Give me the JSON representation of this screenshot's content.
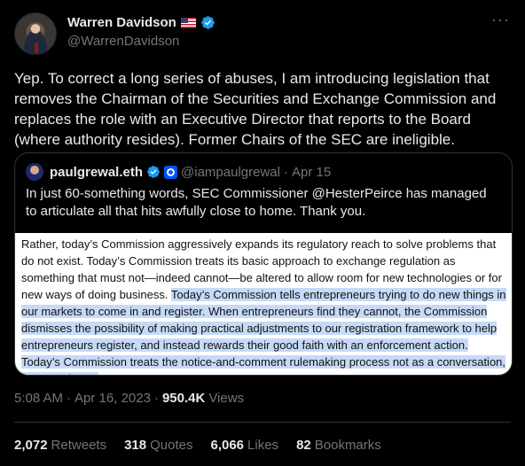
{
  "author": {
    "display_name": "Warren Davidson",
    "handle": "@WarrenDavidson",
    "flag_icon": "us-flag-icon",
    "verified_color": "#1d9bf0"
  },
  "tweet": {
    "text": "Yep. To correct a long series of abuses, I am introducing legislation that removes the Chairman of the Securities and Exchange Commission and replaces the role with an Executive Director that reports to the Board (where authority resides). Former Chairs of the SEC are ineligible.",
    "time": "5:08 AM",
    "date": "Apr 16, 2023",
    "views_count": "950.4K",
    "views_label": "Views"
  },
  "quote": {
    "display_name": "paulgrewal.eth",
    "handle": "@iampaulgrewal",
    "date": "Apr 15",
    "text": "In just 60-something words, SEC Commissioner @HesterPeirce has managed to articulate all that hits awfully close to home. Thank you.",
    "image_text_plain": "Rather, today’s Commission aggressively expands its regulatory reach to solve problems that do not exist. Today’s Commission treats its basic approach to exchange regulation as something that must not—indeed cannot—be altered to allow room for new technologies or for new ways of doing business. ",
    "image_text_highlight": "Today’s Commission tells entrepreneurs trying to do new things in our markets to come in and register. When entrepreneurs find they cannot, the Commission dismisses the possibility of making practical adjustments to our registration framework to help entrepreneurs register, and instead rewards their good faith with an enforcement action. Today’s Commission treats the notice-and-comment rulemaking process not as a conversation, but as a threat."
  },
  "stats": {
    "retweets_count": "2,072",
    "retweets_label": "Retweets",
    "quotes_count": "318",
    "quotes_label": "Quotes",
    "likes_count": "6,066",
    "likes_label": "Likes",
    "bookmarks_count": "82",
    "bookmarks_label": "Bookmarks"
  },
  "colors": {
    "background": "#000000",
    "text": "#e7e9ea",
    "muted": "#71767b",
    "border": "#2f3336",
    "highlight": "#c6daf7"
  }
}
